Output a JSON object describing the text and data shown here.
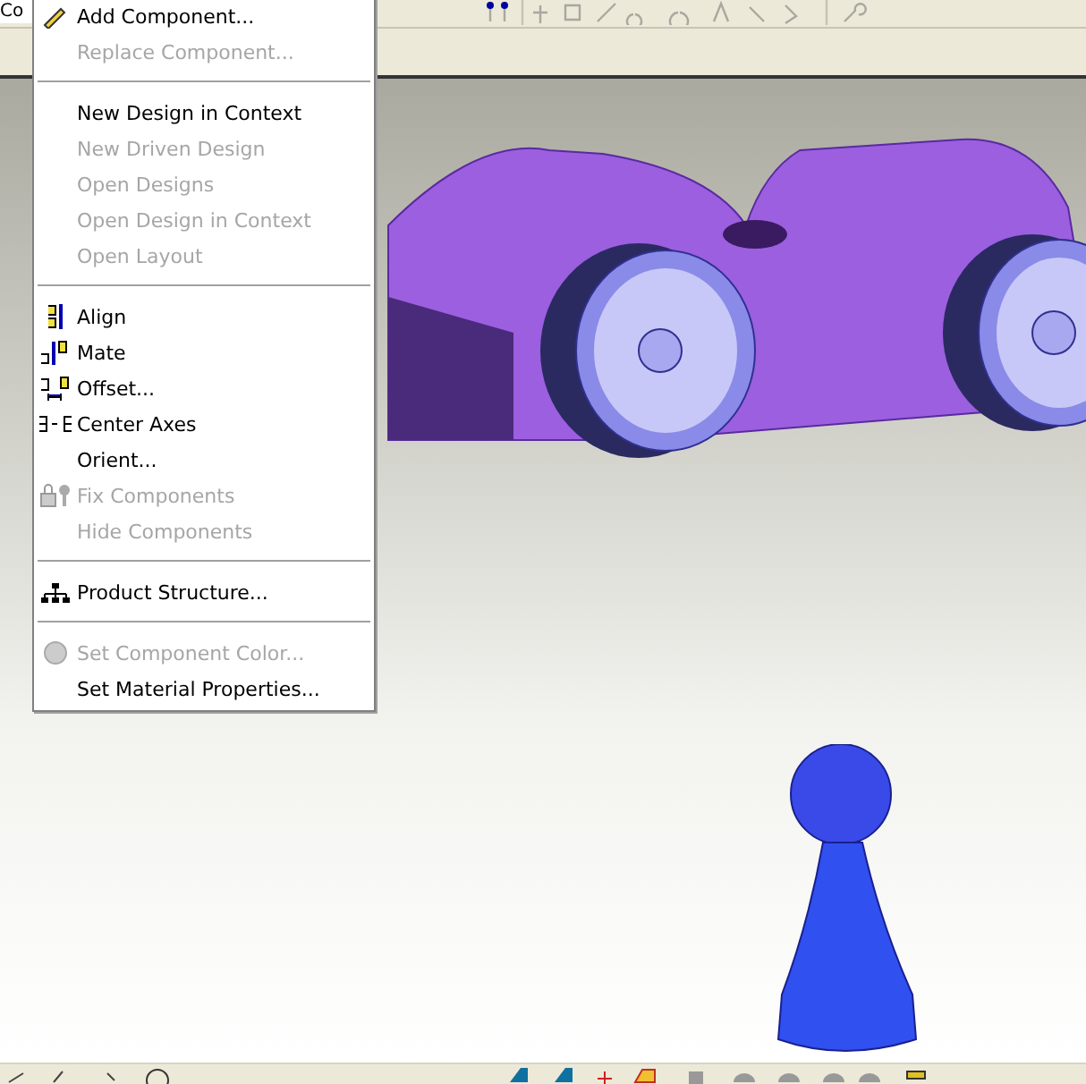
{
  "combo": {
    "value": "Co"
  },
  "context_menu": {
    "groups": [
      [
        {
          "label": "Add Component...",
          "disabled": false
        },
        {
          "label": "Replace Component...",
          "disabled": true
        }
      ],
      [
        {
          "label": "New Design in Context",
          "disabled": false
        },
        {
          "label": "New Driven Design",
          "disabled": true
        },
        {
          "label": "Open Designs",
          "disabled": true
        },
        {
          "label": "Open Design in Context",
          "disabled": true
        },
        {
          "label": "Open Layout",
          "disabled": true
        }
      ],
      [
        {
          "label": "Align",
          "disabled": false
        },
        {
          "label": "Mate",
          "disabled": false
        },
        {
          "label": "Offset...",
          "disabled": false
        },
        {
          "label": "Center Axes",
          "disabled": false
        },
        {
          "label": "Orient...",
          "disabled": false
        },
        {
          "label": "Fix Components",
          "disabled": true
        },
        {
          "label": "Hide Components",
          "disabled": true
        }
      ],
      [
        {
          "label": "Product Structure...",
          "disabled": false
        }
      ],
      [
        {
          "label": "Set Component Color...",
          "disabled": true
        },
        {
          "label": "Set Material Properties...",
          "disabled": false
        }
      ]
    ]
  }
}
